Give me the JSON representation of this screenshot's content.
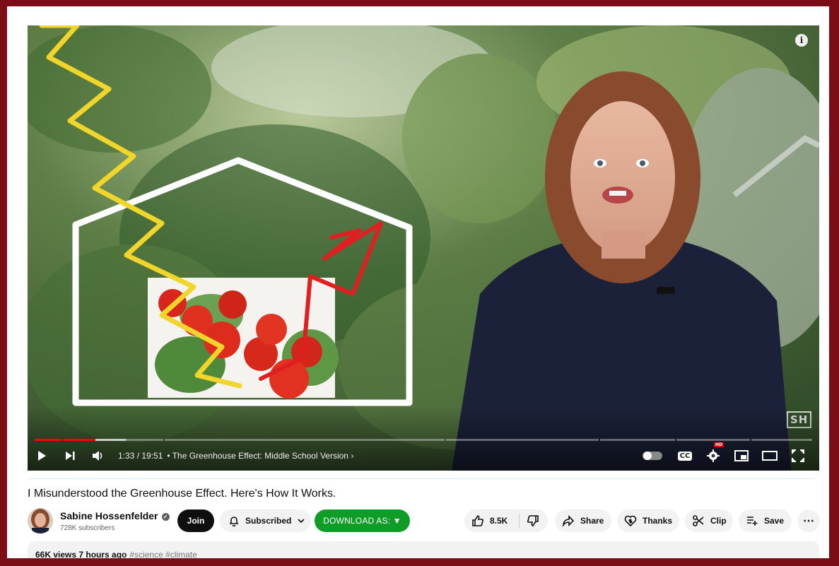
{
  "player": {
    "info_icon": "info-icon",
    "watermark": "SH",
    "time": "1:33 / 19:51",
    "chapter_separator": "•",
    "chapter": "The Greenhouse Effect: Middle School Version",
    "progress_fraction": 0.0781,
    "icons": [
      "play-icon",
      "next-icon",
      "volume-icon",
      "autoplay-toggle-icon",
      "captions-icon",
      "settings-icon",
      "miniplayer-icon",
      "theater-icon",
      "fullscreen-icon"
    ],
    "cc_label": "CC",
    "hd_badge": "HD"
  },
  "video": {
    "title": "I Misunderstood the Greenhouse Effect. Here's How It Works."
  },
  "channel": {
    "name": "Sabine Hossenfelder",
    "subscribers": "728K subscribers",
    "verified_icon": "verified-check-icon"
  },
  "actions": {
    "join": "Join",
    "subscribed": "Subscribed",
    "download": "DOWNLOAD AS: ▼",
    "likes": "8.5K",
    "share": "Share",
    "thanks": "Thanks",
    "clip": "Clip",
    "save": "Save",
    "more": "⋯"
  },
  "description": {
    "views_time": "66K views  7 hours ago",
    "tags": "#science #climate"
  },
  "colors": {
    "frame": "#7a0d16",
    "progress": "#ff0000",
    "download_button": "#0f9d28",
    "join_button": "#0f0f0f"
  }
}
